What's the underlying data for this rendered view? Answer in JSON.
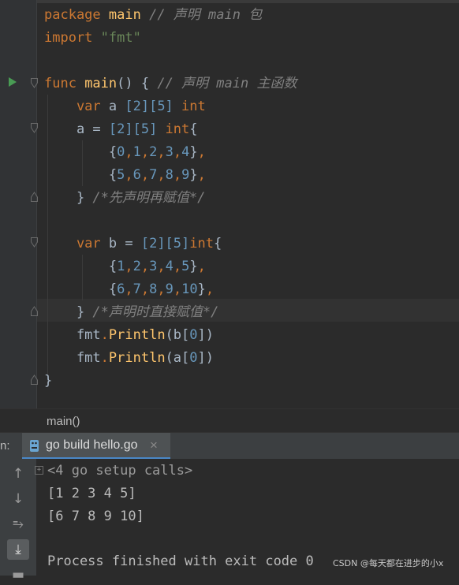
{
  "editor": {
    "lines": [
      [
        {
          "t": "package ",
          "c": "kw"
        },
        {
          "t": "main",
          "c": "fn"
        },
        {
          "t": " // 声明 main 包",
          "c": "cm"
        }
      ],
      [
        {
          "t": "import ",
          "c": "kw"
        },
        {
          "t": "\"fmt\"",
          "c": "str"
        }
      ],
      [],
      [
        {
          "t": "func ",
          "c": "kw"
        },
        {
          "t": "main",
          "c": "fn"
        },
        {
          "t": "() { ",
          "c": "plain"
        },
        {
          "t": "// 声明 main 主函数",
          "c": "cm"
        }
      ],
      [
        {
          "t": "    var ",
          "c": "kw"
        },
        {
          "t": "a ",
          "c": "plain"
        },
        {
          "t": "[2][5] ",
          "c": "num"
        },
        {
          "t": "int",
          "c": "kw"
        }
      ],
      [
        {
          "t": "    a = ",
          "c": "plain"
        },
        {
          "t": "[2][5] ",
          "c": "num"
        },
        {
          "t": "int",
          "c": "kw"
        },
        {
          "t": "{",
          "c": "plain"
        }
      ],
      [
        {
          "t": "        {",
          "c": "plain"
        },
        {
          "t": "0",
          "c": "num"
        },
        {
          "t": ",",
          "c": "kw"
        },
        {
          "t": "1",
          "c": "num"
        },
        {
          "t": ",",
          "c": "kw"
        },
        {
          "t": "2",
          "c": "num"
        },
        {
          "t": ",",
          "c": "kw"
        },
        {
          "t": "3",
          "c": "num"
        },
        {
          "t": ",",
          "c": "kw"
        },
        {
          "t": "4",
          "c": "num"
        },
        {
          "t": "}",
          "c": "plain"
        },
        {
          "t": ",",
          "c": "kw"
        }
      ],
      [
        {
          "t": "        {",
          "c": "plain"
        },
        {
          "t": "5",
          "c": "num"
        },
        {
          "t": ",",
          "c": "kw"
        },
        {
          "t": "6",
          "c": "num"
        },
        {
          "t": ",",
          "c": "kw"
        },
        {
          "t": "7",
          "c": "num"
        },
        {
          "t": ",",
          "c": "kw"
        },
        {
          "t": "8",
          "c": "num"
        },
        {
          "t": ",",
          "c": "kw"
        },
        {
          "t": "9",
          "c": "num"
        },
        {
          "t": "}",
          "c": "plain"
        },
        {
          "t": ",",
          "c": "kw"
        }
      ],
      [
        {
          "t": "    } ",
          "c": "plain"
        },
        {
          "t": "/*先声明再赋值*/",
          "c": "cm"
        }
      ],
      [],
      [
        {
          "t": "    var ",
          "c": "kw"
        },
        {
          "t": "b = ",
          "c": "plain"
        },
        {
          "t": "[2][5]",
          "c": "num"
        },
        {
          "t": "int",
          "c": "kw"
        },
        {
          "t": "{",
          "c": "plain"
        }
      ],
      [
        {
          "t": "        {",
          "c": "plain"
        },
        {
          "t": "1",
          "c": "num"
        },
        {
          "t": ",",
          "c": "kw"
        },
        {
          "t": "2",
          "c": "num"
        },
        {
          "t": ",",
          "c": "kw"
        },
        {
          "t": "3",
          "c": "num"
        },
        {
          "t": ",",
          "c": "kw"
        },
        {
          "t": "4",
          "c": "num"
        },
        {
          "t": ",",
          "c": "kw"
        },
        {
          "t": "5",
          "c": "num"
        },
        {
          "t": "}",
          "c": "plain"
        },
        {
          "t": ",",
          "c": "kw"
        }
      ],
      [
        {
          "t": "        {",
          "c": "plain"
        },
        {
          "t": "6",
          "c": "num"
        },
        {
          "t": ",",
          "c": "kw"
        },
        {
          "t": "7",
          "c": "num"
        },
        {
          "t": ",",
          "c": "kw"
        },
        {
          "t": "8",
          "c": "num"
        },
        {
          "t": ",",
          "c": "kw"
        },
        {
          "t": "9",
          "c": "num"
        },
        {
          "t": ",",
          "c": "kw"
        },
        {
          "t": "10",
          "c": "num"
        },
        {
          "t": "}",
          "c": "plain"
        },
        {
          "t": ",",
          "c": "kw"
        }
      ],
      [
        {
          "t": "    } ",
          "c": "plain"
        },
        {
          "t": "/*声明时直接赋值*/",
          "c": "cm"
        }
      ],
      [
        {
          "t": "    fmt",
          "c": "plain"
        },
        {
          "t": ".",
          "c": "kw"
        },
        {
          "t": "Println",
          "c": "fn"
        },
        {
          "t": "(b[",
          "c": "plain"
        },
        {
          "t": "0",
          "c": "num"
        },
        {
          "t": "])",
          "c": "plain"
        }
      ],
      [
        {
          "t": "    fmt",
          "c": "plain"
        },
        {
          "t": ".",
          "c": "kw"
        },
        {
          "t": "Println",
          "c": "fn"
        },
        {
          "t": "(a[",
          "c": "plain"
        },
        {
          "t": "0",
          "c": "num"
        },
        {
          "t": "])",
          "c": "plain"
        }
      ],
      [
        {
          "t": "}",
          "c": "plain"
        }
      ]
    ]
  },
  "breadcrumb": "main()",
  "run_panel": {
    "label": "n:",
    "tab_label": "go build hello.go",
    "close_glyph": "×"
  },
  "console": {
    "setup_calls": "<4 go setup calls>",
    "output": [
      "[1 2 3 4 5]",
      "[6 7 8 9 10]",
      "",
      "Process finished with exit code 0"
    ],
    "tools": [
      "↑",
      "↓",
      "⥱",
      "⤓",
      "▬"
    ]
  },
  "watermark": "CSDN @每天都在进步的小x",
  "colors": {
    "background": "#2b2b2b",
    "keyword": "#cc7832",
    "function": "#ffc66d",
    "string": "#6a8759",
    "number": "#6897bb",
    "comment": "#808080",
    "run_arrow": "#499c54",
    "tab_underline": "#4a88c7"
  }
}
